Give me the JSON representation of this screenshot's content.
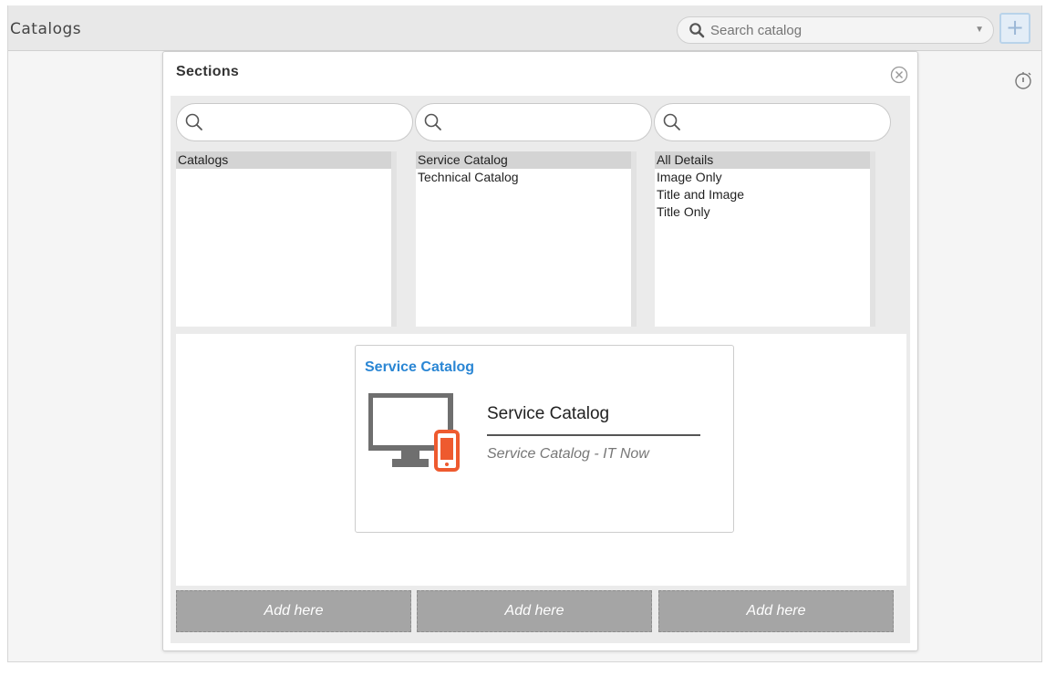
{
  "topbar": {
    "title": "Catalogs",
    "search_placeholder": "Search catalog",
    "add_label": "+"
  },
  "dialog": {
    "title": "Sections",
    "columns": [
      {
        "items": [
          {
            "label": "Catalogs",
            "selected": true
          }
        ]
      },
      {
        "items": [
          {
            "label": "Service Catalog",
            "selected": true
          },
          {
            "label": "Technical Catalog",
            "selected": false
          }
        ]
      },
      {
        "items": [
          {
            "label": "All Details",
            "selected": true
          },
          {
            "label": "Image Only",
            "selected": false
          },
          {
            "label": "Title and Image",
            "selected": false
          },
          {
            "label": "Title Only",
            "selected": false
          }
        ]
      }
    ],
    "preview": {
      "card_title": "Service Catalog",
      "name": "Service Catalog",
      "subtitle": "Service Catalog - IT Now"
    },
    "add_buttons": [
      "Add here",
      "Add here",
      "Add here"
    ]
  },
  "colors": {
    "accent": "#2a86d4",
    "selected_row": "#d4d4d4",
    "add_button": "#a5a5a5",
    "phone_icon": "#ee5a2f"
  },
  "icons": [
    "search-icon",
    "dropdown-caret-icon",
    "plus-icon",
    "timer-icon",
    "close-icon",
    "monitor-phone-icon"
  ]
}
